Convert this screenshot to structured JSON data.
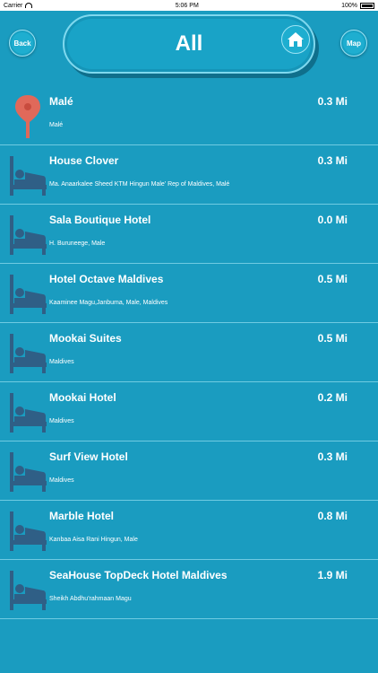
{
  "status_bar": {
    "carrier": "Carrier",
    "time": "5:06 PM",
    "battery": "100%"
  },
  "header": {
    "back_label": "Back",
    "title": "All",
    "map_label": "Map"
  },
  "colors": {
    "background": "#1a9cc0",
    "pin": "#e0695a",
    "bed": "#2f5f86"
  },
  "places": [
    {
      "name": "Malé",
      "address": "Malé",
      "distance": "0.3 Mi",
      "icon": "map-pin-icon"
    },
    {
      "name": "House Clover",
      "address": "Ma. Anaarkalee Sheed KTM Hingun Male' Rep of Maldives, Malé",
      "distance": "0.3 Mi",
      "icon": "bed-icon"
    },
    {
      "name": "Sala Boutique Hotel",
      "address": "H. Buruneege, Male",
      "distance": "0.0 Mi",
      "icon": "bed-icon"
    },
    {
      "name": "Hotel Octave Maldives",
      "address": "Kaaminee Magu,Janbuma, Male, Maldives",
      "distance": "0.5 Mi",
      "icon": "bed-icon"
    },
    {
      "name": "Mookai Suites",
      "address": "Maldives",
      "distance": "0.5 Mi",
      "icon": "bed-icon"
    },
    {
      "name": "Mookai Hotel",
      "address": "Maldives",
      "distance": "0.2 Mi",
      "icon": "bed-icon"
    },
    {
      "name": "Surf View Hotel",
      "address": "Maldives",
      "distance": "0.3 Mi",
      "icon": "bed-icon"
    },
    {
      "name": "Marble Hotel",
      "address": "Kanbaa Aisa Rani Hingun, Male",
      "distance": "0.8 Mi",
      "icon": "bed-icon"
    },
    {
      "name": "SeaHouse TopDeck Hotel Maldives",
      "address": "Sheikh Abdhu'rahmaan Magu",
      "distance": "1.9 Mi",
      "icon": "bed-icon"
    }
  ]
}
